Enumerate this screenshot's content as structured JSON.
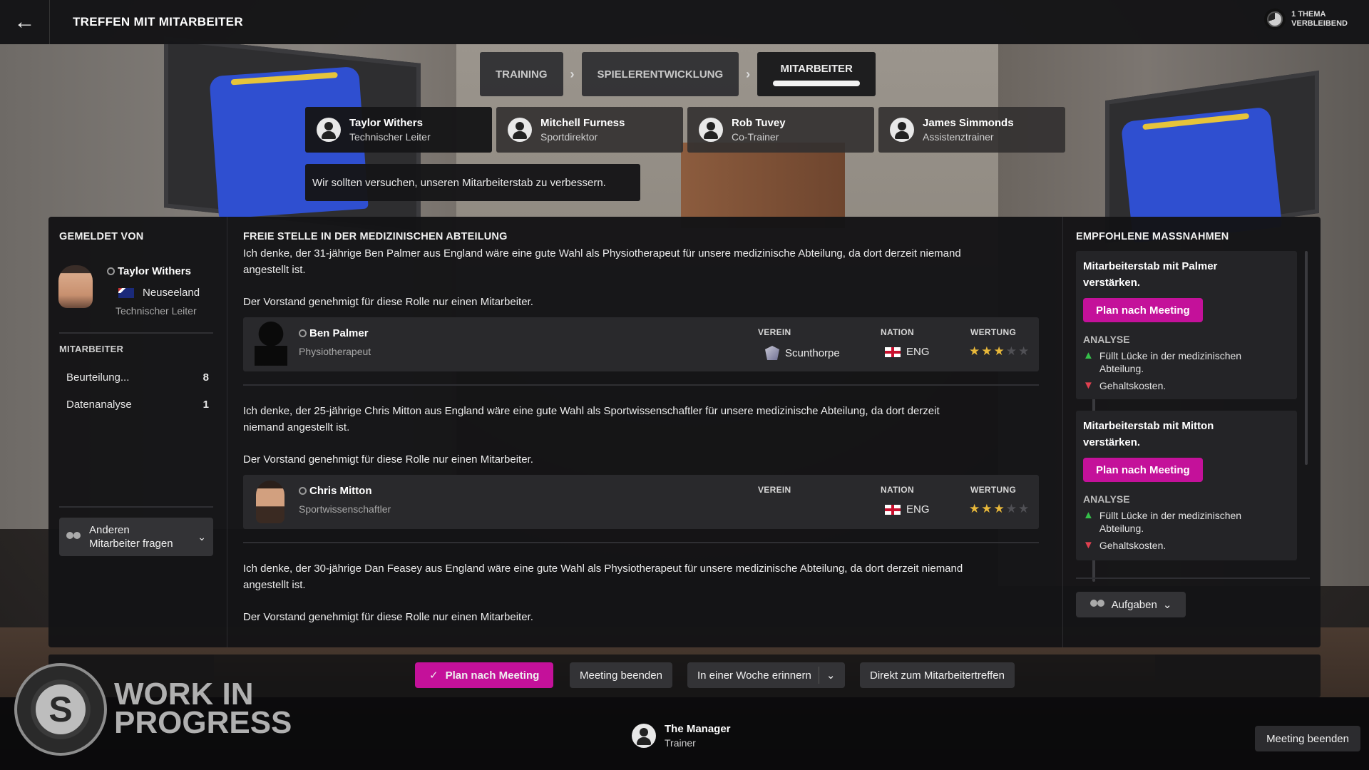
{
  "header": {
    "title": "TREFFEN MIT MITARBEITER",
    "topic_counter_line1": "1 THEMA",
    "topic_counter_line2": "VERBLEIBEND"
  },
  "stage_tabs": [
    {
      "label": "TRAINING",
      "active": false
    },
    {
      "label": "SPIELERENTWICKLUNG",
      "active": false
    },
    {
      "label": "MITARBEITER",
      "active": true
    }
  ],
  "staff": [
    {
      "name": "Taylor Withers",
      "role": "Technischer Leiter",
      "selected": true
    },
    {
      "name": "Mitchell Furness",
      "role": "Sportdirektor",
      "selected": false
    },
    {
      "name": "Rob Tuvey",
      "role": "Co-Trainer",
      "selected": false
    },
    {
      "name": "James Simmonds",
      "role": "Assistenztrainer",
      "selected": false
    }
  ],
  "speech": "Wir sollten versuchen, unseren Mitarbeiterstab zu verbessern.",
  "reported_by": {
    "title": "GEMELDET VON",
    "name": "Taylor Withers",
    "nation": "Neuseeland",
    "role": "Technischer Leiter"
  },
  "staff_section": {
    "title": "MITARBEITER",
    "items": [
      {
        "label": "Beurteilung...",
        "count": "8"
      },
      {
        "label": "Datenanalyse",
        "count": "1"
      }
    ],
    "ask_line1": "Anderen",
    "ask_line2": "Mitarbeiter fragen"
  },
  "vacancy": {
    "title": "FREIE STELLE IN DER MEDIZINISCHEN ABTEILUNG",
    "headers": {
      "club": "VEREIN",
      "nation": "NATION",
      "rating": "WERTUNG"
    },
    "candidates": [
      {
        "text_1": "Ich denke, der 31-jährige Ben Palmer aus England wäre eine gute Wahl als Physiotherapeut für unsere medizinische Abteilung, da dort derzeit niemand",
        "text_2": "angestellt ist.",
        "board": "Der Vorstand genehmigt für diese Rolle nur einen Mitarbeiter.",
        "name": "Ben Palmer",
        "role": "Physiotherapeut",
        "club": "Scunthorpe",
        "nation": "ENG",
        "stars": 3,
        "max_stars": 5
      },
      {
        "text_1": "Ich denke, der 25-jährige Chris Mitton aus England wäre eine gute Wahl als Sportwissenschaftler für unsere medizinische Abteilung, da dort derzeit",
        "text_2": "niemand angestellt ist.",
        "board": "Der Vorstand genehmigt für diese Rolle nur einen Mitarbeiter.",
        "name": "Chris Mitton",
        "role": "Sportwissenschaftler",
        "club": "",
        "nation": "ENG",
        "stars": 3,
        "max_stars": 5
      },
      {
        "text_1": "Ich denke, der 30-jährige Dan Feasey aus England wäre eine gute Wahl als Physiotherapeut für unsere medizinische Abteilung, da dort derzeit niemand",
        "text_2": "angestellt ist.",
        "board": "Der Vorstand genehmigt für diese Rolle nur einen Mitarbeiter."
      }
    ]
  },
  "recommended": {
    "title": "EMPFOHLENE MASSNAHMEN",
    "actions": [
      {
        "title_1": "Mitarbeiterstab mit Palmer",
        "title_2": "verstärken.",
        "button": "Plan nach Meeting",
        "analysis_title": "ANALYSE",
        "pro_1": "Füllt Lücke in der medizinischen",
        "pro_2": "Abteilung.",
        "con": "Gehaltskosten."
      },
      {
        "title_1": "Mitarbeiterstab mit Mitton",
        "title_2": "verstärken.",
        "button": "Plan nach Meeting",
        "analysis_title": "ANALYSE",
        "pro_1": "Füllt Lücke in der medizinischen",
        "pro_2": "Abteilung.",
        "con": "Gehaltskosten."
      }
    ],
    "tasks_button": "Aufgaben"
  },
  "action_bar": {
    "plan": "Plan nach Meeting",
    "end": "Meeting beenden",
    "remind": "In einer Woche erinnern",
    "direct": "Direkt zum Mitarbeitertreffen"
  },
  "footer": {
    "wip_line1": "WORK IN",
    "wip_line2": "PROGRESS",
    "manager_name": "The Manager",
    "manager_role": "Trainer",
    "end_button": "Meeting beenden"
  },
  "colors": {
    "accent": "#c4119a",
    "star_on": "#e8b83a",
    "pro": "#35c04a",
    "con": "#e04050"
  }
}
